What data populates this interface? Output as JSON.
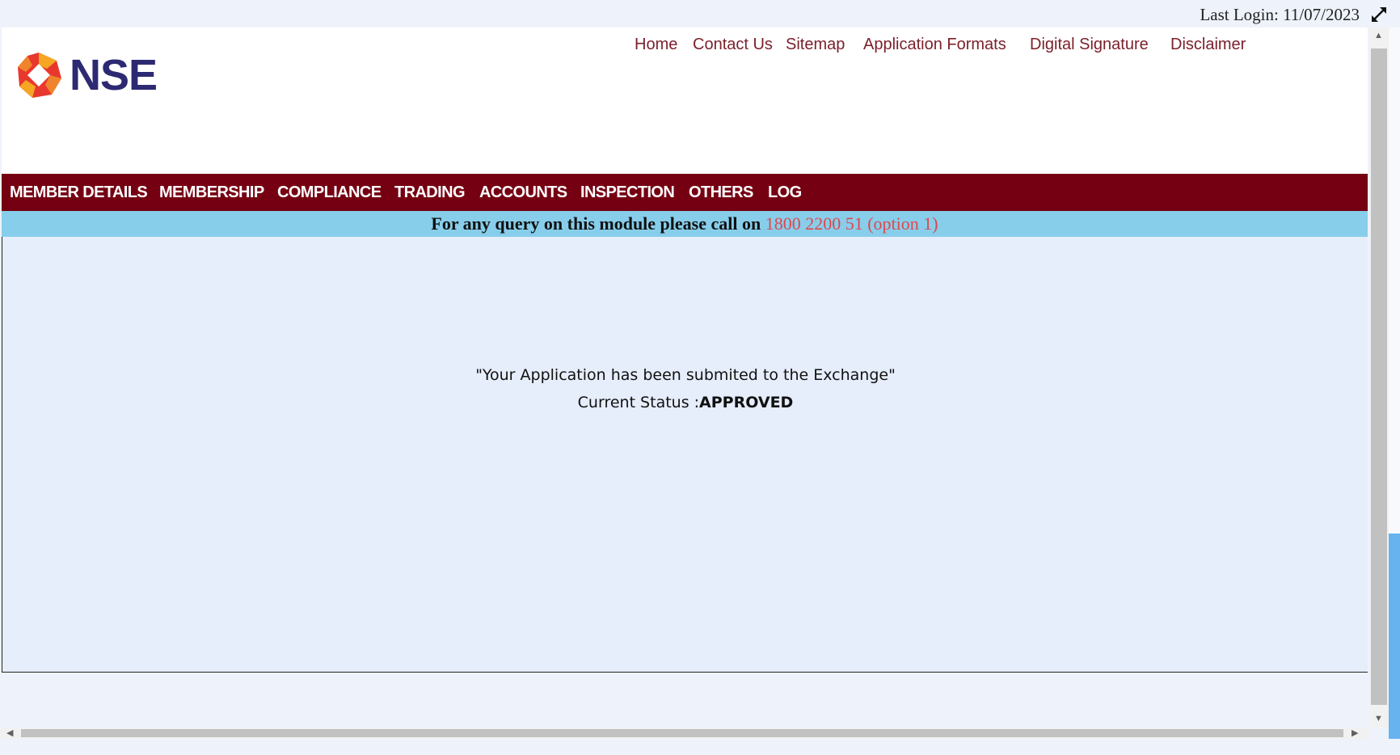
{
  "header": {
    "last_login": "Last Login: 11/07/2023",
    "expand_icon": "expand-arrows-icon",
    "logo_text": "NSE",
    "logo_colors": [
      "#e8382e",
      "#f5a623",
      "#2d2a73"
    ]
  },
  "top_links": [
    "Home",
    "Contact Us",
    "Sitemap",
    "Application Formats",
    "Digital Signature",
    "Disclaimer"
  ],
  "main_nav": [
    "MEMBER DETAILS",
    "MEMBERSHIP",
    "COMPLIANCE",
    "TRADING",
    "ACCOUNTS",
    "INSPECTION",
    "OTHERS",
    "LOG"
  ],
  "query_band": {
    "text": "For any query on this module please call on",
    "phone": "1800 2200 51 (option 1)"
  },
  "content": {
    "message": "\"Your Application has been submited to the Exchange\"",
    "status_label": "Current Status :",
    "status_value": "APPROVED"
  },
  "colors": {
    "nav_background": "#750012",
    "query_band_background": "#87ceeb",
    "link_color": "#7b1f2a",
    "phone_color": "#e0474c"
  }
}
